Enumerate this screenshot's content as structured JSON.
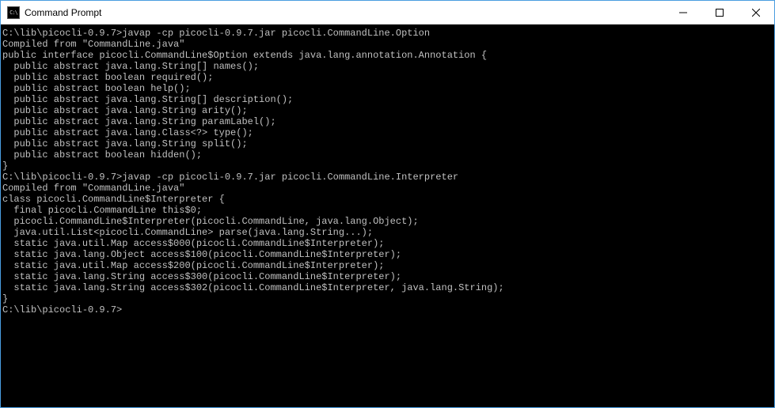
{
  "window": {
    "title": "Command Prompt"
  },
  "terminal": {
    "lines": [
      "",
      "C:\\lib\\picocli-0.9.7>javap -cp picocli-0.9.7.jar picocli.CommandLine.Option",
      "Compiled from \"CommandLine.java\"",
      "public interface picocli.CommandLine$Option extends java.lang.annotation.Annotation {",
      "  public abstract java.lang.String[] names();",
      "  public abstract boolean required();",
      "  public abstract boolean help();",
      "  public abstract java.lang.String[] description();",
      "  public abstract java.lang.String arity();",
      "  public abstract java.lang.String paramLabel();",
      "  public abstract java.lang.Class<?> type();",
      "  public abstract java.lang.String split();",
      "  public abstract boolean hidden();",
      "}",
      "",
      "C:\\lib\\picocli-0.9.7>javap -cp picocli-0.9.7.jar picocli.CommandLine.Interpreter",
      "Compiled from \"CommandLine.java\"",
      "class picocli.CommandLine$Interpreter {",
      "  final picocli.CommandLine this$0;",
      "  picocli.CommandLine$Interpreter(picocli.CommandLine, java.lang.Object);",
      "  java.util.List<picocli.CommandLine> parse(java.lang.String...);",
      "  static java.util.Map access$000(picocli.CommandLine$Interpreter);",
      "  static java.lang.Object access$100(picocli.CommandLine$Interpreter);",
      "  static java.util.Map access$200(picocli.CommandLine$Interpreter);",
      "  static java.lang.String access$300(picocli.CommandLine$Interpreter);",
      "  static java.lang.String access$302(picocli.CommandLine$Interpreter, java.lang.String);",
      "}",
      "",
      "C:\\lib\\picocli-0.9.7>"
    ]
  }
}
